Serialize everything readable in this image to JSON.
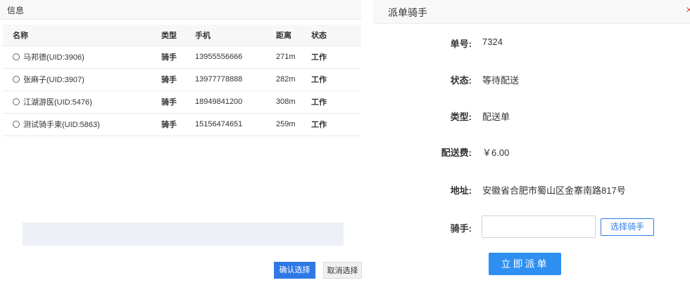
{
  "left": {
    "header_title": "信息",
    "columns": [
      "名称",
      "类型",
      "手机",
      "距离",
      "状态"
    ],
    "rows": [
      {
        "name": "马邦德(UID:3906)",
        "type": "骑手",
        "phone": "13955556666",
        "distance": "271m",
        "status": "工作"
      },
      {
        "name": "张麻子(UID:3907)",
        "type": "骑手",
        "phone": "13977778888",
        "distance": "282m",
        "status": "工作"
      },
      {
        "name": "江湖游医(UID:5476)",
        "type": "骑手",
        "phone": "18949841200",
        "distance": "308m",
        "status": "工作"
      },
      {
        "name": "测试骑手柬(UID:5863)",
        "type": "骑手",
        "phone": "15156474651",
        "distance": "259m",
        "status": "工作"
      }
    ],
    "confirm_label": "确认选择",
    "cancel_label": "取消选择"
  },
  "right": {
    "header_title": "派单骑手",
    "close_glyph": "×",
    "order_no_label": "单号:",
    "order_no": "7324",
    "status_label": "状态:",
    "status": "等待配送",
    "type_label": "类型:",
    "type": "配送单",
    "fee_label": "配送费:",
    "fee": "￥6.00",
    "address_label": "地址:",
    "address": "安徽省合肥市蜀山区金寨南路817号",
    "rider_label": "骑手:",
    "rider_value": "",
    "choose_rider_label": "选择骑手",
    "dispatch_label": "立即派单"
  },
  "colors": {
    "accent_blue": "#2e8ff0",
    "link_blue": "#1c64c8",
    "close_red": "#e2463b"
  }
}
